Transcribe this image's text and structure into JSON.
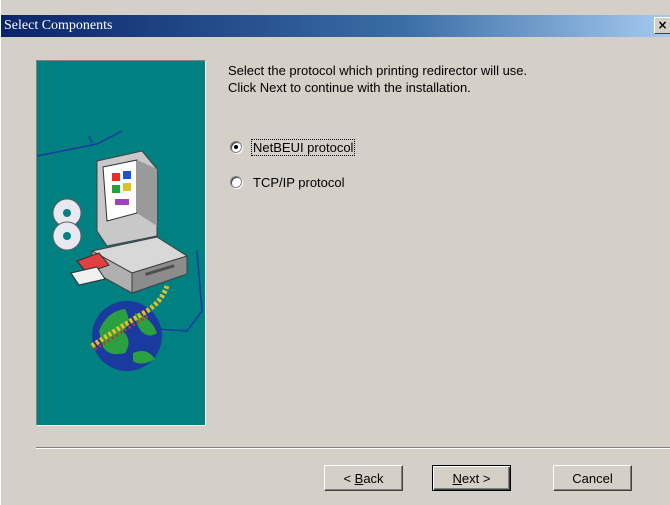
{
  "window": {
    "title": "Select Components",
    "close_glyph": "✕"
  },
  "instructions": {
    "line1": "Select the protocol which printing redirector will use.",
    "line2": "Click Next to continue with the installation."
  },
  "options": [
    {
      "label": "NetBEUI protocol",
      "selected": true
    },
    {
      "label": "TCP/IP protocol",
      "selected": false
    }
  ],
  "buttons": {
    "back_prefix": "< ",
    "back_hotkey": "B",
    "back_rest": "ack",
    "next_hotkey": "N",
    "next_rest": "ext >",
    "cancel": "Cancel"
  },
  "colors": {
    "dialog_bg": "#d4d0c8",
    "title_bar": "#0a246a",
    "image_bg": "#008080"
  }
}
